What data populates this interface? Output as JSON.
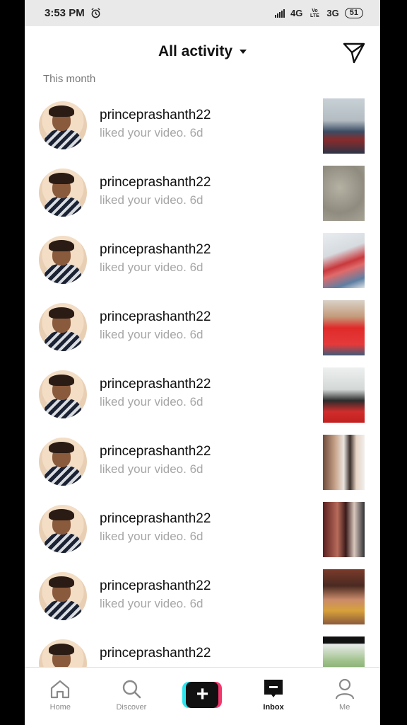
{
  "status_bar": {
    "time": "3:53 PM",
    "network_1": "4G",
    "volte": "Vo LTE",
    "network_2": "3G",
    "battery": "51"
  },
  "header": {
    "title": "All activity"
  },
  "section_label": "This month",
  "notifications": [
    {
      "user": "princeprashanth22",
      "action": "liked your video.",
      "age": "6d"
    },
    {
      "user": "princeprashanth22",
      "action": "liked your video.",
      "age": "6d"
    },
    {
      "user": "princeprashanth22",
      "action": "liked your video.",
      "age": "6d"
    },
    {
      "user": "princeprashanth22",
      "action": "liked your video.",
      "age": "6d"
    },
    {
      "user": "princeprashanth22",
      "action": "liked your video.",
      "age": "6d"
    },
    {
      "user": "princeprashanth22",
      "action": "liked your video.",
      "age": "6d"
    },
    {
      "user": "princeprashanth22",
      "action": "liked your video.",
      "age": "6d"
    },
    {
      "user": "princeprashanth22",
      "action": "liked your video.",
      "age": "6d"
    },
    {
      "user": "princeprashanth22",
      "action": "",
      "age": ""
    }
  ],
  "tabs": [
    {
      "label": "Home",
      "icon": "home-icon"
    },
    {
      "label": "Discover",
      "icon": "search-icon"
    },
    {
      "label": "",
      "icon": "plus-icon"
    },
    {
      "label": "Inbox",
      "icon": "inbox-icon"
    },
    {
      "label": "Me",
      "icon": "person-icon"
    }
  ],
  "colors": {
    "accent_cyan": "#29e6f1",
    "accent_magenta": "#f4366b",
    "muted_text": "#a6a6a6"
  }
}
